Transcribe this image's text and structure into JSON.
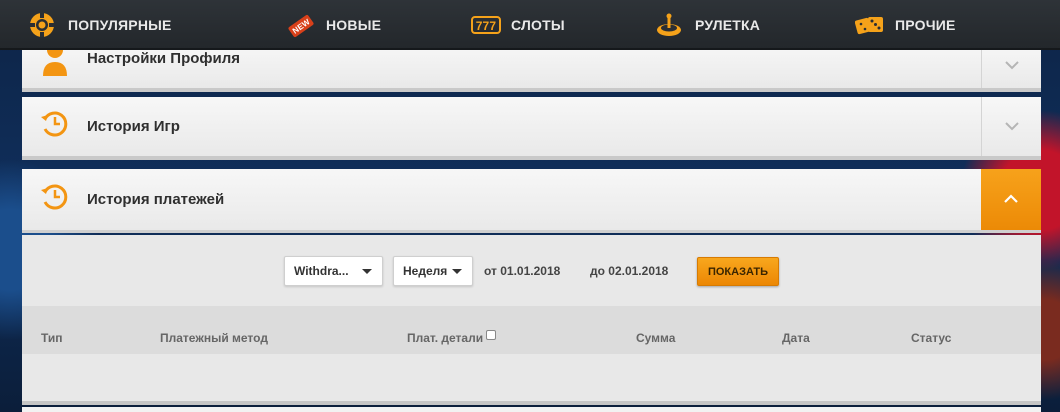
{
  "nav": {
    "items": [
      {
        "label": "ПОПУЛЯРНЫЕ",
        "icon": "poker-chip-icon"
      },
      {
        "label": "НОВЫЕ",
        "icon": "new-badge-icon",
        "badge": "NEW"
      },
      {
        "label": "СЛОТЫ",
        "icon": "slot-777-icon"
      },
      {
        "label": "РУЛЕТКА",
        "icon": "roulette-icon"
      },
      {
        "label": "ПРОЧИЕ",
        "icon": "dice-icon"
      }
    ]
  },
  "panels": {
    "profile": {
      "title": "Настройки Профиля",
      "icon": "user-icon"
    },
    "game_history": {
      "title": "История Игр",
      "icon": "history-clock-icon"
    },
    "payment_history": {
      "title": "История платежей",
      "icon": "history-clock-icon"
    }
  },
  "filters": {
    "type_select": "Withdra...",
    "period_select": "Неделя",
    "date_from": "от 01.01.2018",
    "date_to": "до 02.01.2018",
    "show_button": "ПОКАЗАТЬ"
  },
  "table": {
    "columns": [
      "Тип",
      "Платежный метод",
      "Плат. детали",
      "Сумма",
      "Дата",
      "Статус"
    ],
    "rows": []
  },
  "colors": {
    "accent": "#f39512",
    "nav_bg": "#2a2e33",
    "panel_bg": "#efefef",
    "background": "#0d2446"
  }
}
